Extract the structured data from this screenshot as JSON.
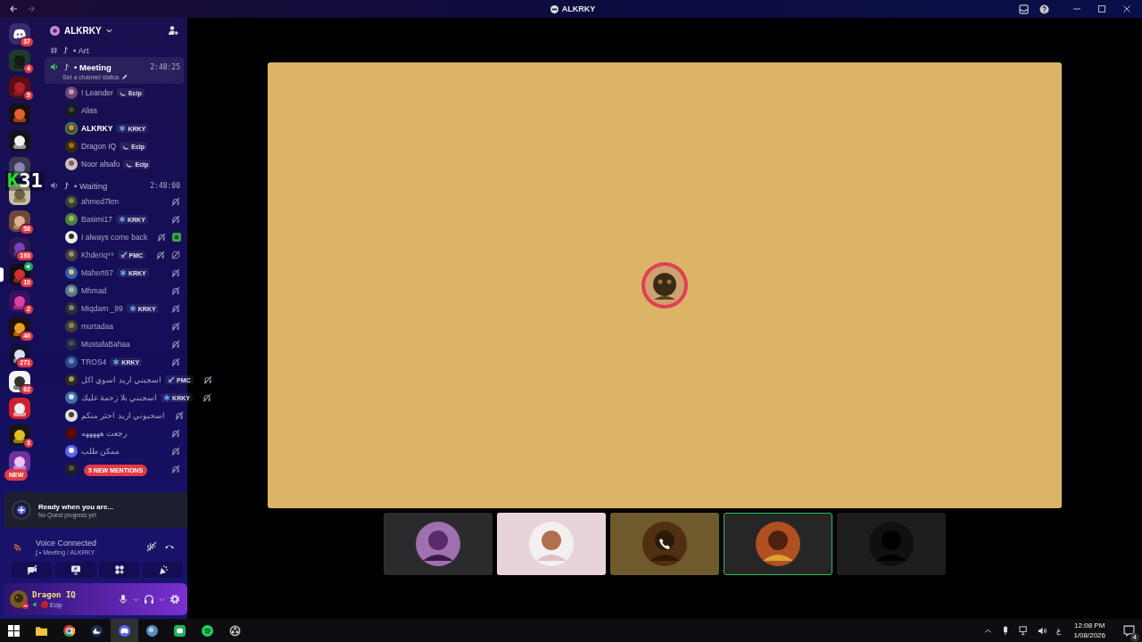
{
  "window": {
    "title": "ALKRKY"
  },
  "servers": [
    {
      "kind": "home",
      "badge": "37",
      "selected": false,
      "in_voice": false
    },
    {
      "kind": "picture",
      "badge": "4",
      "selected": false,
      "in_voice": false
    },
    {
      "kind": "picture",
      "badge": "5",
      "selected": false,
      "in_voice": false
    },
    {
      "kind": "picture",
      "selected": false,
      "in_voice": false
    },
    {
      "kind": "picture",
      "selected": false,
      "in_voice": false
    },
    {
      "kind": "picture",
      "selected": false,
      "in_voice": false
    },
    {
      "kind": "picture",
      "selected": false,
      "in_voice": false
    },
    {
      "kind": "picture",
      "badge": "58",
      "selected": false,
      "in_voice": false
    },
    {
      "kind": "picture",
      "badge": "193",
      "selected": false,
      "in_voice": false
    },
    {
      "kind": "picture",
      "badge": "10",
      "selected": true,
      "in_voice": true
    },
    {
      "kind": "picture",
      "badge": "2",
      "selected": false,
      "in_voice": false
    },
    {
      "kind": "picture",
      "badge": "40",
      "selected": false,
      "in_voice": false
    },
    {
      "kind": "picture",
      "badge": "271",
      "selected": false,
      "in_voice": false
    },
    {
      "kind": "picture",
      "badge": "62",
      "selected": false,
      "in_voice": false
    },
    {
      "kind": "picture",
      "selected": false,
      "in_voice": false
    },
    {
      "kind": "picture",
      "badge": "3",
      "selected": false,
      "in_voice": false
    },
    {
      "kind": "picture",
      "selected": false,
      "in_voice": false
    }
  ],
  "new_pill": "NEW",
  "overlay": {
    "prefix": "K",
    "number": "31"
  },
  "server_header": {
    "name": "ALKRKY"
  },
  "channels": [
    {
      "kind": "text",
      "name": "• Art",
      "selected": false
    },
    {
      "kind": "voice",
      "name": "• Meeting",
      "time": "2:48:25",
      "status": "Set a channel status",
      "selected": true,
      "members": [
        {
          "name": "! Leander",
          "tag": {
            "kind": "moon",
            "text": "Eclp"
          },
          "speaking": false,
          "deafened": false,
          "muted": false,
          "activity": false
        },
        {
          "name": "Aliss",
          "speaking": false,
          "deafened": false,
          "muted": false,
          "activity": false
        },
        {
          "name": "ALKRKY",
          "tag": {
            "kind": "snow",
            "text": "KRKY"
          },
          "speaking": true,
          "deafened": false,
          "muted": false,
          "activity": false
        },
        {
          "name": "Dragon IQ",
          "tag": {
            "kind": "moon",
            "text": "Eclp"
          },
          "speaking": false,
          "deafened": false,
          "muted": false,
          "activity": false
        },
        {
          "name": "Noor alsafo",
          "tag": {
            "kind": "moon",
            "text": "Eclp"
          },
          "speaking": false,
          "deafened": false,
          "muted": false,
          "activity": false
        }
      ]
    },
    {
      "kind": "voice",
      "name": "• Waiting",
      "time": "2:48:00",
      "selected": false,
      "members": [
        {
          "name": "ahmed7km",
          "speaking": false,
          "deafened": true,
          "muted": false,
          "activity": false
        },
        {
          "name": "Basimi17",
          "tag": {
            "kind": "snow",
            "text": "KRKY"
          },
          "speaking": false,
          "deafened": true,
          "muted": false,
          "activity": false
        },
        {
          "name": "I always come back",
          "speaking": false,
          "deafened": true,
          "muted": false,
          "activity": true
        },
        {
          "name": "Khderiq⁹⁹",
          "tag": {
            "kind": "sword",
            "text": "PMC"
          },
          "speaking": false,
          "deafened": true,
          "muted": true,
          "activity": false
        },
        {
          "name": "Mahert67",
          "tag": {
            "kind": "snow",
            "text": "KRKY"
          },
          "speaking": false,
          "deafened": true,
          "muted": false,
          "activity": false
        },
        {
          "name": "Mhmad",
          "speaking": false,
          "deafened": true,
          "muted": false,
          "activity": false
        },
        {
          "name": "Miqdam _99",
          "tag": {
            "kind": "snow",
            "text": "KRKY"
          },
          "speaking": false,
          "deafened": true,
          "muted": false,
          "activity": false
        },
        {
          "name": "murtadaa",
          "speaking": false,
          "deafened": true,
          "muted": false,
          "activity": false
        },
        {
          "name": "MustafaBahaa",
          "speaking": false,
          "deafened": true,
          "muted": false,
          "activity": false
        },
        {
          "name": "TROS4",
          "tag": {
            "kind": "snow",
            "text": "KRKY"
          },
          "speaking": false,
          "deafened": true,
          "muted": false,
          "activity": false
        },
        {
          "name": "اسجبني اريد اسوي اكل",
          "tag": {
            "kind": "sword",
            "text": "PMC"
          },
          "speaking": false,
          "deafened": true,
          "muted": false,
          "activity": false
        },
        {
          "name": "اسجبني بلا زحمة عليك",
          "tag": {
            "kind": "snow",
            "text": "KRKY"
          },
          "speaking": false,
          "deafened": true,
          "muted": false,
          "activity": false
        },
        {
          "name": "اسحبوني اريد احتر منكم",
          "speaking": false,
          "deafened": true,
          "muted": false,
          "activity": false
        },
        {
          "name": "رجعت هههههه",
          "speaking": false,
          "deafened": true,
          "muted": false,
          "activity": false
        },
        {
          "name": "ممكن طلب",
          "speaking": false,
          "deafened": true,
          "muted": false,
          "activity": false
        },
        {
          "speaking": false,
          "deafened": true,
          "muted": false,
          "activity": false
        }
      ]
    }
  ],
  "mentions_pill": "5 NEW MENTIONS",
  "quest": {
    "title": "Ready when you are...",
    "subtitle": "No Quest progress yet"
  },
  "voice": {
    "status": "Voice Connected",
    "channel": "ʄ • Meeting / ALKRKY"
  },
  "user": {
    "name": "Dragon IQ",
    "status": "Eclp"
  },
  "stream": {
    "main": {
      "kind": "avatar"
    },
    "tiles": [
      {
        "kind": "avatar",
        "selected": false
      },
      {
        "kind": "avatar",
        "selected": false
      },
      {
        "kind": "call",
        "selected": false
      },
      {
        "kind": "avatar",
        "selected": true
      },
      {
        "kind": "avatar",
        "selected": false
      }
    ]
  },
  "taskbar": {
    "apps": [
      {
        "kind": "start",
        "active": false
      },
      {
        "kind": "folder",
        "active": false
      },
      {
        "kind": "browser",
        "active": false
      },
      {
        "kind": "boat",
        "active": false
      },
      {
        "kind": "chat",
        "active": true
      },
      {
        "kind": "orb",
        "active": false
      },
      {
        "kind": "chat2",
        "active": false
      },
      {
        "kind": "music",
        "active": false
      },
      {
        "kind": "record",
        "active": false
      }
    ],
    "language": "ع",
    "time": "12:08 PM",
    "date": "1/08/2026",
    "notifications": "4"
  }
}
